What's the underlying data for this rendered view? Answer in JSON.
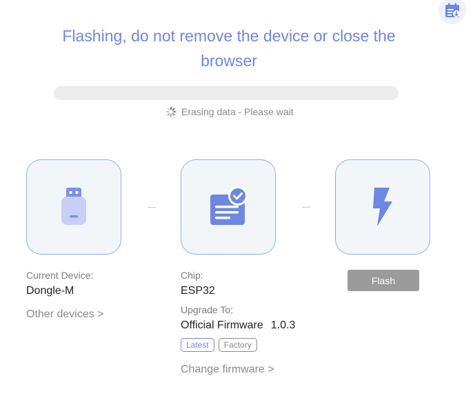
{
  "header": {
    "title": "Flashing, do not remove the device or close the browser",
    "corner_icon": "calendar-download-icon"
  },
  "progress": {
    "fraction": 0,
    "status_text": "Erasing data - Please wait",
    "status_icon": "loading-spinner-icon"
  },
  "device": {
    "icon": "usb-dongle-icon",
    "label": "Current Device:",
    "name": "Dongle-M",
    "other_link": "Other devices >"
  },
  "chip": {
    "icon": "firmware-document-check-icon",
    "label": "Chip:",
    "name": "ESP32",
    "upgrade_label": "Upgrade To:",
    "firmware_name": "Official Firmware",
    "firmware_version": "1.0.3",
    "tags": [
      "Latest",
      "Factory"
    ],
    "change_link": "Change firmware >"
  },
  "flash": {
    "icon": "lightning-bolt-icon",
    "button_label": "Flash"
  },
  "colors": {
    "accent": "#6d87e3",
    "card_border": "#8fb0e0",
    "card_bg": "#f2f6f9",
    "button_disabled": "#9b9b9b"
  }
}
